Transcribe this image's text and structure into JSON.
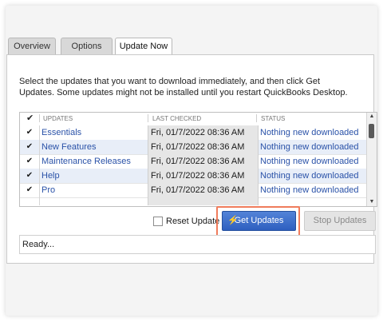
{
  "tabs": [
    {
      "label": "Overview",
      "active": false
    },
    {
      "label": "Options",
      "active": false
    },
    {
      "label": "Update Now",
      "active": true
    }
  ],
  "instructions": "Select the updates that you want to download immediately, and then click Get Updates. Some updates might not be installed until you restart QuickBooks Desktop.",
  "grid": {
    "check_header": "✔",
    "headers": {
      "updates": "UPDATES",
      "last_checked": "LAST CHECKED",
      "status": "STATUS"
    },
    "rows": [
      {
        "checked": "✔",
        "name": "Essentials",
        "last_checked": "Fri, 01/7/2022 08:36 AM",
        "status": "Nothing new downloaded"
      },
      {
        "checked": "✔",
        "name": "New Features",
        "last_checked": "Fri, 01/7/2022 08:36 AM",
        "status": "Nothing new downloaded"
      },
      {
        "checked": "✔",
        "name": "Maintenance Releases",
        "last_checked": "Fri, 01/7/2022 08:36 AM",
        "status": "Nothing new downloaded"
      },
      {
        "checked": "✔",
        "name": "Help",
        "last_checked": "Fri, 01/7/2022 08:36 AM",
        "status": "Nothing new downloaded"
      },
      {
        "checked": "✔",
        "name": "Pro",
        "last_checked": "Fri, 01/7/2022 08:36 AM",
        "status": "Nothing new downloaded"
      }
    ]
  },
  "reset_update": {
    "label": "Reset Update",
    "checked": false
  },
  "buttons": {
    "get_updates": "Get Updates",
    "stop_updates": "Stop Updates"
  },
  "status_text": "Ready...",
  "colors": {
    "highlight_outline": "#f07c5c",
    "primary_button": "#2e5fbf",
    "link_text": "#2a52a8"
  }
}
